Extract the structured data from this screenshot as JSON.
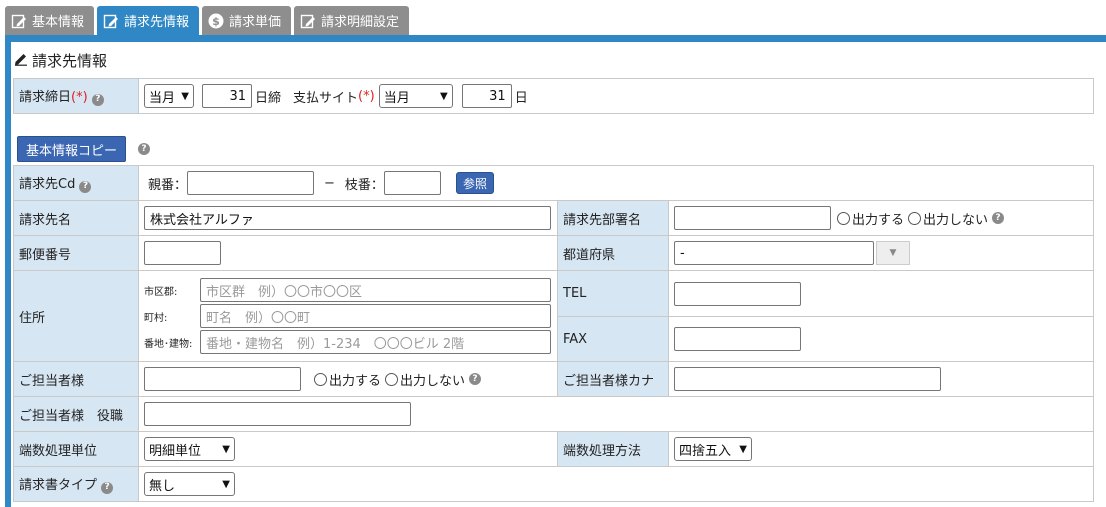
{
  "tabs": [
    {
      "label": "基本情報",
      "icon": "edit-icon"
    },
    {
      "label": "請求先情報",
      "icon": "edit-icon"
    },
    {
      "label": "請求単価",
      "icon": "dollar-icon"
    },
    {
      "label": "請求明細設定",
      "icon": "edit-icon"
    }
  ],
  "section": {
    "title": "請求先情報"
  },
  "closing": {
    "label": "請求締日",
    "required_mark": "(*)",
    "month": "当月",
    "day": "31",
    "suffix": "日締",
    "pay_label": "支払サイト",
    "pay_required": "(*)",
    "pay_month": "当月",
    "pay_day": "31",
    "pay_suffix": "日"
  },
  "copy_button": "基本情報コピー",
  "fields": {
    "code_label": "請求先Cd",
    "parent_label": "親番：",
    "dash": "−",
    "branch_label": "枝番：",
    "ref_button": "参照",
    "name_label": "請求先名",
    "name_value": "株式会社アルファ",
    "dept_label": "請求先部署名",
    "output_yes": "出力する",
    "output_no": "出力しない",
    "zip_label": "郵便番号",
    "pref_label": "都道府県",
    "pref_value": "-",
    "address_label": "住所",
    "city_label": "市区郡:",
    "city_placeholder": "市区群　例）〇〇市〇〇区",
    "town_label": "町村:",
    "town_placeholder": "町名　例）〇〇町",
    "street_label": "番地･建物:",
    "street_placeholder": "番地・建物名　例）1-234　〇〇〇ビル 2階",
    "tel_label": "TEL",
    "fax_label": "FAX",
    "person_label": "ご担当者様",
    "person_kana_label": "ご担当者様カナ",
    "title_label": "ご担当者様　役職",
    "rounding_unit_label": "端数処理単位",
    "rounding_unit_value": "明細単位",
    "rounding_method_label": "端数処理方法",
    "rounding_method_value": "四捨五入",
    "invoice_type_label": "請求書タイプ",
    "invoice_type_value": "無し"
  }
}
